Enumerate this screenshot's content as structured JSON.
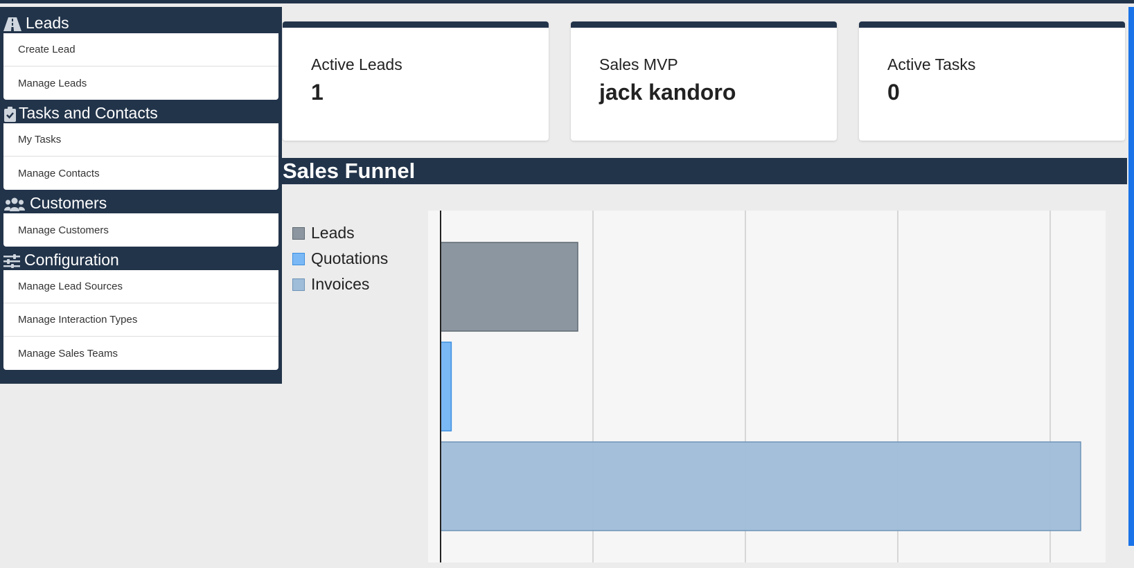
{
  "sidebar": {
    "sections": [
      {
        "title": "Leads",
        "icon": "road-icon",
        "items": [
          "Create Lead",
          "Manage Leads"
        ]
      },
      {
        "title": "Tasks and Contacts",
        "icon": "clipboard-check-icon",
        "items": [
          "My Tasks",
          "Manage Contacts"
        ]
      },
      {
        "title": "Customers",
        "icon": "users-icon",
        "items": [
          "Manage Customers"
        ]
      },
      {
        "title": "Configuration",
        "icon": "sliders-icon",
        "items": [
          "Manage Lead Sources",
          "Manage Interaction Types",
          "Manage Sales Teams"
        ]
      }
    ]
  },
  "cards": [
    {
      "label": "Active Leads",
      "value": "1"
    },
    {
      "label": "Sales MVP",
      "value": "jack kandoro"
    },
    {
      "label": "Active Tasks",
      "value": "0"
    }
  ],
  "funnel": {
    "title": "Sales Funnel"
  },
  "colors": {
    "navy": "#22344a",
    "leads": "#8c96a0",
    "quotations": "#7ab8f5",
    "invoices": "#9fbcd8"
  },
  "chart_data": {
    "type": "bar",
    "orientation": "horizontal",
    "categories": [
      "Leads",
      "Quotations",
      "Invoices"
    ],
    "values": [
      0.9,
      0.07,
      4.2
    ],
    "xlim": [
      0,
      4.3
    ],
    "grid": true,
    "legend_placement": "left",
    "series": [
      {
        "name": "Leads",
        "color": "#8c96a0"
      },
      {
        "name": "Quotations",
        "color": "#7ab8f5"
      },
      {
        "name": "Invoices",
        "color": "#9fbcd8"
      }
    ]
  }
}
